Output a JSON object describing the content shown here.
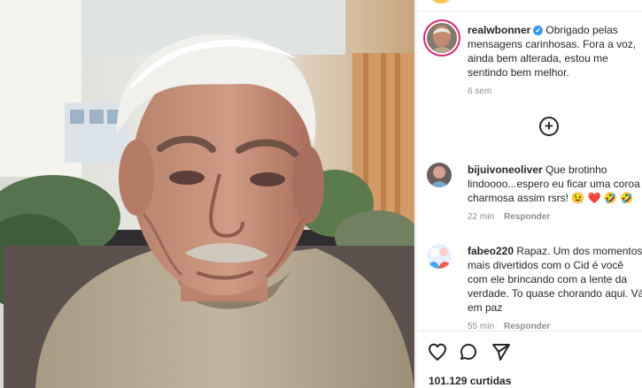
{
  "post": {
    "username": "realwbonner",
    "verified_mark": "✔",
    "caption": "Obrigado pelas mensagens carinhosas. Fora a voz, ainda bem alterada, estou me sentindo bem melhor.",
    "time": "6 sem",
    "avatar_icon": "profile-photo",
    "more_comments_icon": "plus-circle-icon"
  },
  "comments": [
    {
      "username": "bijuivoneoliver",
      "text": "Que brotinho lindoooo...espero eu ficar uma coroa charmosa assim rsrs! 😉 ❤️ 🤣 🤣",
      "time": "22 min",
      "reply": "Responder"
    },
    {
      "username": "fabeo220",
      "text": "Rapaz. Um dos momentos mais divertidos com o Cid é você com ele brincando com a lente da verdade. To quase chorando aqui. Vá em paz",
      "time": "55 min",
      "reply": "Responder"
    }
  ],
  "actions": {
    "like_icon": "heart-icon",
    "comment_icon": "comment-icon",
    "share_icon": "send-icon"
  },
  "likes": "101.129 curtidas",
  "colors": {
    "verified": "#3897f0",
    "text": "#262626",
    "muted": "#8e8e8e",
    "story_ring": "#d62976"
  }
}
